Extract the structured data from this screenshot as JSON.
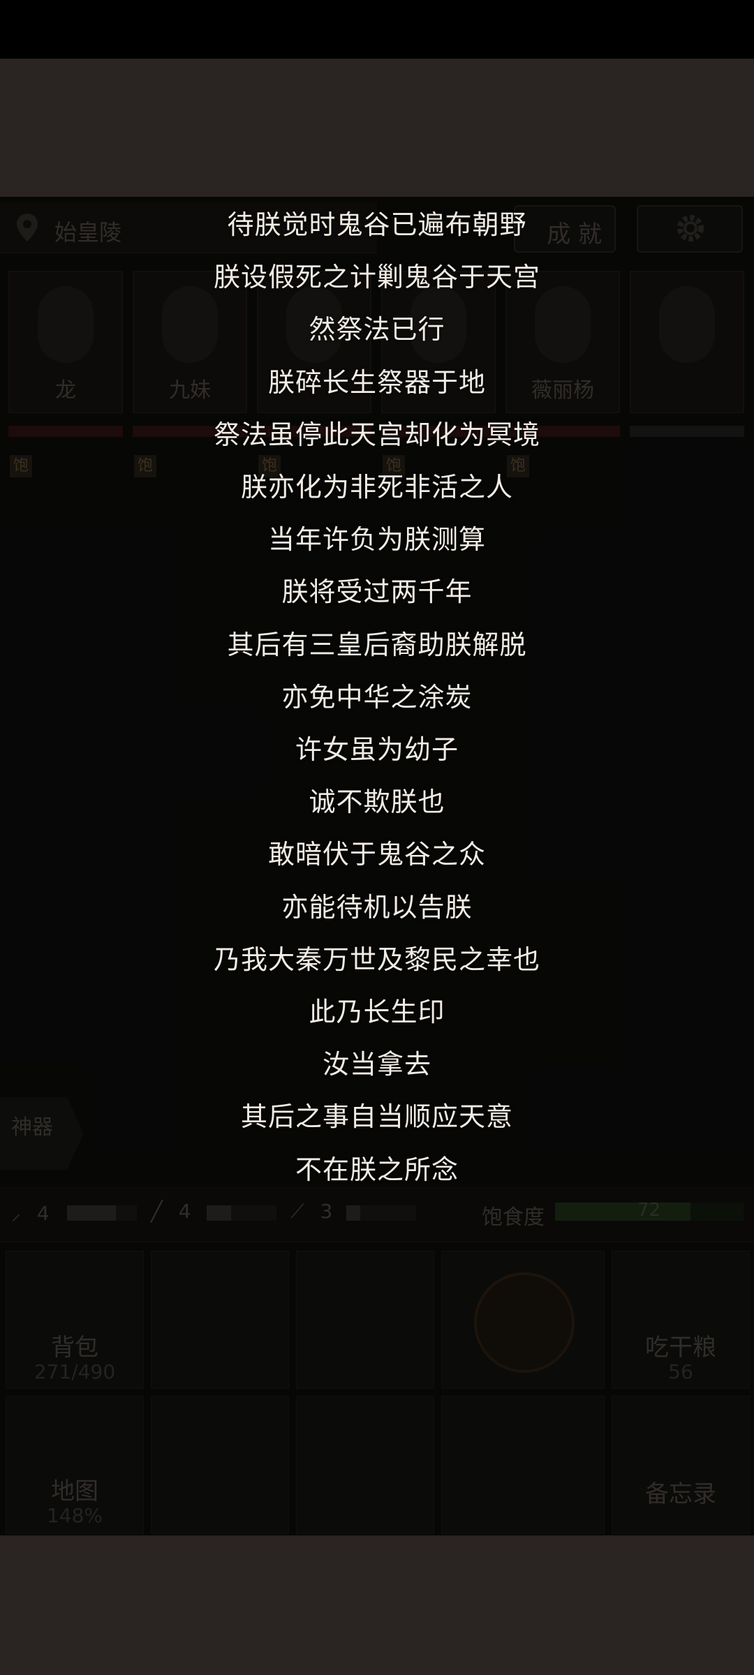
{
  "location": {
    "name": "始皇陵"
  },
  "header": {
    "achievement_label": "成 就"
  },
  "party": [
    {
      "name": "龙",
      "status": "饱"
    },
    {
      "name": "九妹",
      "status": "饱"
    },
    {
      "name": "",
      "status": "饱"
    },
    {
      "name": "",
      "status": "饱"
    },
    {
      "name": "薇丽杨",
      "status": "饱"
    },
    {
      "name": "",
      "status": ""
    }
  ],
  "artifact_tab": {
    "label": "神器"
  },
  "tools": [
    {
      "icon": "torch-icon",
      "count": "4",
      "level": 0.7
    },
    {
      "icon": "rope-icon",
      "count": "4",
      "level": 0.35
    },
    {
      "icon": "shovel-icon",
      "count": "3",
      "level": 0.2
    }
  ],
  "satiety": {
    "label": "饱食度",
    "value": "72"
  },
  "actions": {
    "backpack": {
      "label": "背包",
      "sub": "271/490"
    },
    "eat": {
      "label": "吃干粮",
      "sub": "56"
    },
    "map": {
      "label": "地图",
      "sub": "148%"
    },
    "memo": {
      "label": "备忘录"
    }
  },
  "story_lines": [
    "待朕觉时鬼谷已遍布朝野",
    "朕设假死之计剿鬼谷于天宫",
    "然祭法已行",
    "朕碎长生祭器于地",
    "祭法虽停此天宫却化为冥境",
    "朕亦化为非死非活之人",
    "当年许负为朕测算",
    "朕将受过两千年",
    "其后有三皇后裔助朕解脱",
    "亦免中华之涂炭",
    "许女虽为幼子",
    "诚不欺朕也",
    "敢暗伏于鬼谷之众",
    "亦能待机以告朕",
    "乃我大秦万世及黎民之幸也",
    "此乃长生印",
    "汝当拿去",
    "其后之事自当顺应天意",
    "不在朕之所念"
  ]
}
